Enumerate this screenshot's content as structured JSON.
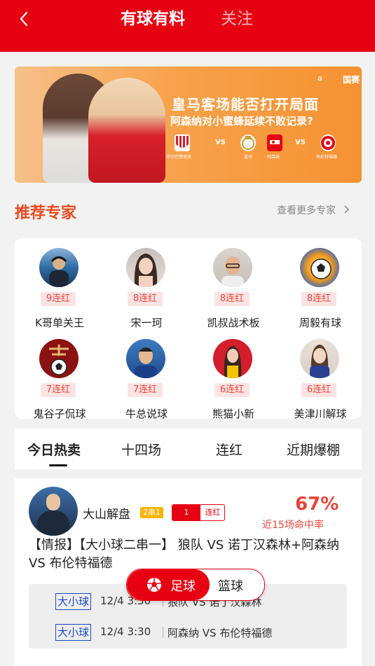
{
  "header": {
    "tabs": [
      {
        "label": "有球有料",
        "active": true
      },
      {
        "label": "关注",
        "active": false
      }
    ]
  },
  "banner": {
    "brand_mark": "a",
    "brand_name": "国赛",
    "title": "皇马客场能否打开局面",
    "subtitle": "阿森纳对小蜜蜂延续不败记录?",
    "matches": [
      {
        "home": "毕尔巴鄂竞技",
        "away": "皇马"
      },
      {
        "home": "阿森纳",
        "away": "布伦特福德"
      }
    ],
    "vs": "VS"
  },
  "recommend": {
    "title": "推荐专家",
    "more": "查看更多专家"
  },
  "experts": [
    {
      "name": "K哥单关王",
      "streak": "9连红",
      "avatar": "avatar-stadium"
    },
    {
      "name": "宋一珂",
      "streak": "8连红",
      "avatar": "avatar-woman"
    },
    {
      "name": "凯叔战术板",
      "streak": "8连红",
      "avatar": "avatar-man"
    },
    {
      "name": "周毅有球",
      "streak": "8连红",
      "avatar": "avatar-football"
    },
    {
      "name": "鬼谷子侃球",
      "streak": "7连红",
      "avatar": "avatar-logo"
    },
    {
      "name": "牛总说球",
      "streak": "7连红",
      "avatar": "avatar-player"
    },
    {
      "name": "熊猫小新",
      "streak": "6连红",
      "avatar": "avatar-woman-red"
    },
    {
      "name": "美津川解球",
      "streak": "6连红",
      "avatar": "avatar-woman-blue"
    }
  ],
  "tabs": [
    {
      "label": "今日热卖",
      "active": true
    },
    {
      "label": "十四场",
      "active": false
    },
    {
      "label": "连红",
      "active": false
    },
    {
      "label": "近期爆棚",
      "active": false
    }
  ],
  "post": {
    "author": "大山解盘",
    "tag": "2串1",
    "streak_num": "1",
    "streak_label": "连红",
    "hit_rate": "67%",
    "hit_label": "近15场命中率",
    "title": "【情报】【大小球二串一】 狼队 VS 诺丁汉森林+阿森纳 VS 布伦特福德",
    "matches": [
      {
        "type": "大小球",
        "time": "12/4 3:30",
        "teams": "狼队 VS 诺丁汉森林"
      },
      {
        "type": "大小球",
        "time": "12/4 3:30",
        "teams": "阿森纳 VS 布伦特福德"
      }
    ]
  },
  "sport_toggle": {
    "on": "足球",
    "off": "篮球"
  },
  "colors": {
    "brand_red": "#e60012",
    "streak_text": "#e8463c",
    "link_blue": "#1a47c7"
  }
}
